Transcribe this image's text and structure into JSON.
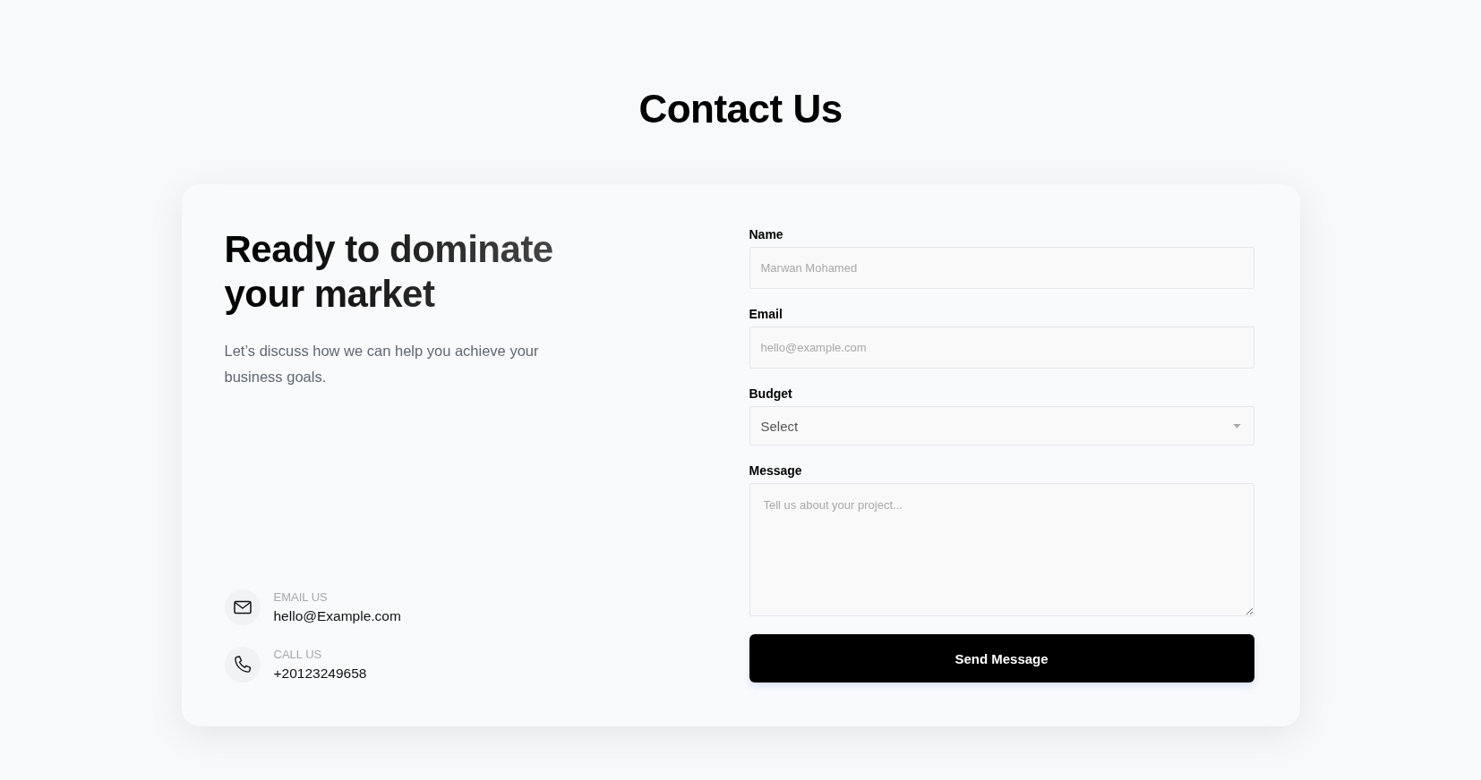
{
  "page": {
    "title": "Contact Us"
  },
  "intro": {
    "heading": "Ready to dominate your market",
    "text": "Let’s discuss how we can help you achieve your business goals."
  },
  "contacts": [
    {
      "kind": "email",
      "label": "EMAIL US",
      "value": "hello@Example.com"
    },
    {
      "kind": "phone",
      "label": "CALL US",
      "value": "+20123249658"
    }
  ],
  "form": {
    "fields": [
      {
        "kind": "text",
        "label": "Name",
        "placeholder": "Marwan Mohamed"
      },
      {
        "kind": "email",
        "label": "Email",
        "placeholder": "hello@example.com"
      },
      {
        "kind": "select",
        "label": "Budget",
        "value": "Select"
      },
      {
        "kind": "textarea",
        "label": "Message",
        "placeholder": "Tell us about your project..."
      }
    ],
    "submit": "Send Message"
  }
}
